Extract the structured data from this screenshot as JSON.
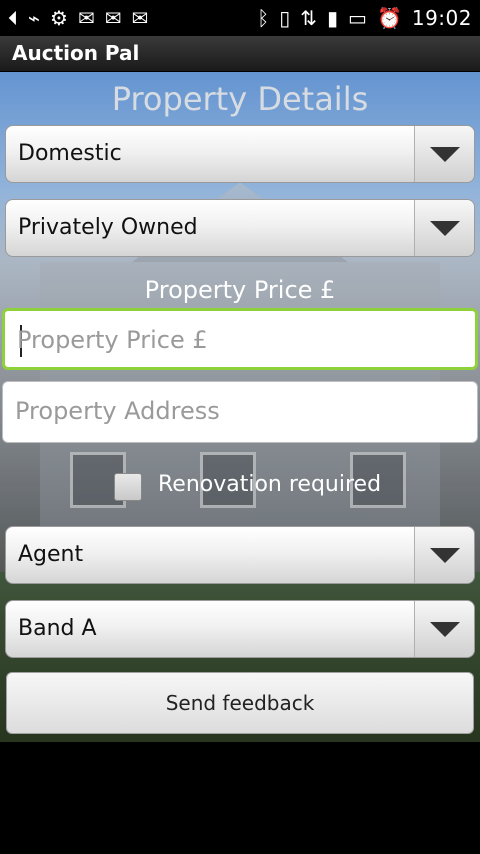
{
  "status_bar": {
    "time": "19:02",
    "icons": [
      "back-icon",
      "usb-icon",
      "android-debug-icon",
      "mail-icon",
      "mail-icon",
      "gmail-icon",
      "bluetooth-icon",
      "vibrate-icon",
      "gprs-icon",
      "signal-icon",
      "battery-charging-icon",
      "alarm-icon"
    ]
  },
  "app": {
    "title": "Auction Pal"
  },
  "form": {
    "heading": "Property Details",
    "property_type": {
      "selected": "Domestic"
    },
    "ownership": {
      "selected": "Privately Owned"
    },
    "price_label": "Property Price £",
    "price_input": {
      "placeholder": "Property Price £",
      "value": ""
    },
    "address_input": {
      "placeholder": "Property Address",
      "value": ""
    },
    "renovation": {
      "label": "Renovation required",
      "checked": false
    },
    "seller": {
      "selected": "Agent"
    },
    "band": {
      "selected": "Band A"
    },
    "submit_label": "Send feedback"
  }
}
